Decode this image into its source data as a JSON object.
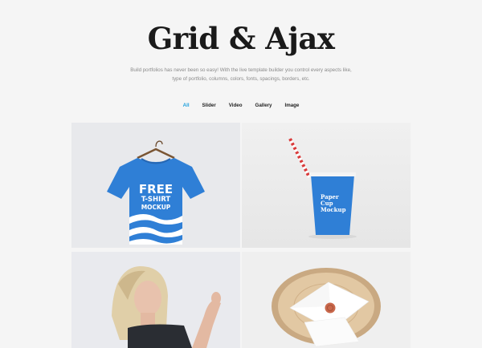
{
  "header": {
    "title": "Grid & Ajax",
    "subtitle": "Build portfolios has never been so easy! With the live template builder you control every aspects like, type of portfolio, columns, colors, fonts, spacings, borders, etc."
  },
  "filters": {
    "active": "All",
    "items": [
      {
        "label": "All"
      },
      {
        "label": "Slider"
      },
      {
        "label": "Video"
      },
      {
        "label": "Gallery"
      },
      {
        "label": "Image"
      }
    ]
  },
  "portfolio": {
    "items": [
      {
        "id": "tshirt",
        "text_lines": [
          "FREE",
          "T-SHIRT",
          "MOCKUP"
        ]
      },
      {
        "id": "cup",
        "text_lines": [
          "Paper",
          "Cup",
          "Mockup"
        ]
      },
      {
        "id": "photo"
      },
      {
        "id": "envelope"
      }
    ]
  },
  "colors": {
    "accent": "#1ea0dc",
    "mockup_blue": "#2f7fd6",
    "straw_red": "#d93b3b",
    "wax_seal": "#c9684b"
  }
}
